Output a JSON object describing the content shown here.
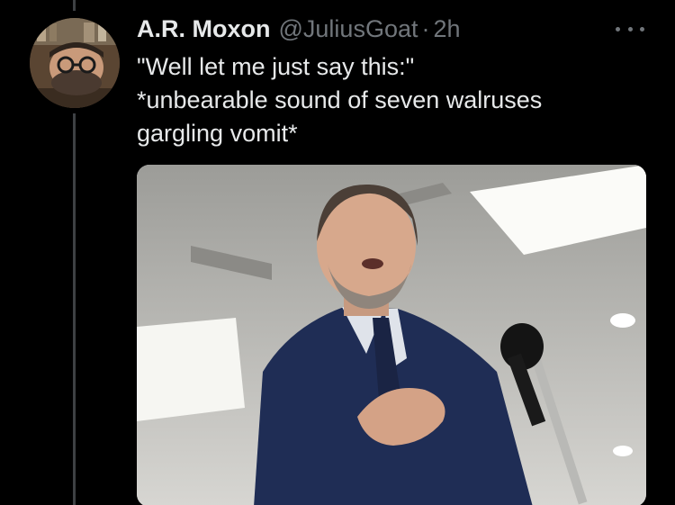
{
  "tweet": {
    "author_name": "A.R. Moxon",
    "author_handle": "@JuliusGoat",
    "separator": "·",
    "timestamp": "2h",
    "text_lines": [
      "\"Well let me just say this:\"",
      "*unbearable sound of seven walruses",
      "gargling vomit*"
    ]
  },
  "icons": {
    "more": "more-horizontal-icon",
    "avatar": "profile-avatar",
    "media": "photo-man-speaking-at-microphone"
  },
  "colors": {
    "background": "#000000",
    "primary_text": "#e7e9ea",
    "secondary_text": "#71767b",
    "thread_line": "#3e4144"
  }
}
